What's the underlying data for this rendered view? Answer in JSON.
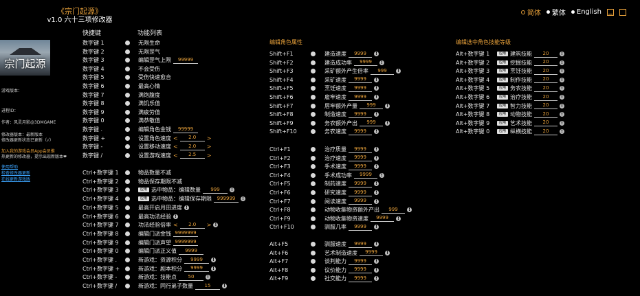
{
  "app": {
    "title": "《宗门起源》",
    "subtitle": "v1.0 六十三项修改器"
  },
  "lang": [
    {
      "label": "简体",
      "selected": true
    },
    {
      "label": "繁体",
      "selected": false
    },
    {
      "label": "English",
      "selected": false
    }
  ],
  "headers": {
    "hotkey": "快捷键",
    "features": "功能列表",
    "char_attr": "编辑角色属性",
    "skill_level": "编辑选中角色技能等级"
  },
  "logo_text": "宗门起源",
  "sidebar": [
    {
      "text": "游戏版本：",
      "cls": ""
    },
    {
      "text": "进程ID：",
      "cls": ""
    },
    {
      "text": "作者：风灵月影@3DMGAME",
      "cls": ""
    },
    {
      "text": "修改器版本：最新版本",
      "cls": ""
    },
    {
      "text": "修改器更新状态已更新（√）",
      "cls": ""
    },
    {
      "text": "加入我的游戏会员App会员推",
      "cls": "orange"
    },
    {
      "text": "热更新的修改器，提示出现新版本❤",
      "cls": ""
    },
    {
      "text": "使用帮助",
      "cls": "link"
    },
    {
      "text": "检查修改器更新",
      "cls": "link"
    },
    {
      "text": "在线更新游戏版",
      "cls": "link"
    }
  ],
  "col1": [
    {
      "key": "数字键 1",
      "label": "无限生命"
    },
    {
      "key": "数字键 2",
      "label": "无限罡气"
    },
    {
      "key": "数字键 3",
      "label": "编辑罡气上限",
      "value": "99999"
    },
    {
      "key": "数字键 4",
      "label": "不会受伤"
    },
    {
      "key": "数字键 5",
      "label": "受伤快速愈合"
    },
    {
      "key": "数字键 6",
      "label": "最高心情"
    },
    {
      "key": "数字键 7",
      "label": "满饱腹度"
    },
    {
      "key": "数字键 8",
      "label": "满饥乐值"
    },
    {
      "key": "数字键 9",
      "label": "满疲劳值"
    },
    {
      "key": "数字键 0",
      "label": "满恭敬值"
    },
    {
      "key": "数字键 .",
      "label": "编辑角色金钱",
      "value": "99999"
    },
    {
      "key": "数字键 +",
      "label": "设置角色速度",
      "value": "2.0",
      "arrows": true
    },
    {
      "key": "数字键 -",
      "label": "设置移动速度",
      "value": "2.0",
      "arrows": true
    },
    {
      "key": "数字键 /",
      "label": "设置游戏速度",
      "value": "2.5",
      "arrows": true
    }
  ],
  "col1b": [
    {
      "key": "Ctrl+数字键 1",
      "label": "物品数量不减"
    },
    {
      "key": "Ctrl+数字键 2",
      "label": "物品保存期限不减"
    },
    {
      "key": "Ctrl+数字键 3",
      "label": "选中物品：编辑数量",
      "value": "999",
      "apply": "应用",
      "info": true
    },
    {
      "key": "Ctrl+数字键 4",
      "label": "选中物品：编辑保存期限",
      "value": "999999",
      "apply": "应用",
      "info": true
    },
    {
      "key": "Ctrl+数字键 5",
      "label": "最高开启月田进度",
      "info": true
    },
    {
      "key": "Ctrl+数字键 6",
      "label": "最高功法经验",
      "info": true
    },
    {
      "key": "Ctrl+数字键 7",
      "label": "功法经验倍率",
      "value": "2.0",
      "arrows": true,
      "info": true
    },
    {
      "key": "Ctrl+数字键 8",
      "label": "编辑门派金钱",
      "value": "9999999"
    },
    {
      "key": "Ctrl+数字键 9",
      "label": "编辑门派声望",
      "value": "9999999"
    },
    {
      "key": "Ctrl+数字键 0",
      "label": "编辑门派正义值",
      "value": "9999"
    },
    {
      "key": "Ctrl+数字键 .",
      "label": "新游戏：资源积分",
      "value": "9999",
      "info": true
    },
    {
      "key": "Ctrl+数字键 +",
      "label": "新游戏：剧本积分",
      "value": "9999",
      "info": true
    },
    {
      "key": "Ctrl+数字键 -",
      "label": "新游戏：技能点",
      "value": "50",
      "info": true
    },
    {
      "key": "Ctrl+数字键 /",
      "label": "新游戏：同行弟子数量",
      "value": "15",
      "info": true
    }
  ],
  "col2": [
    {
      "key": "Shift+F1",
      "label": "建造速度",
      "value": "9999"
    },
    {
      "key": "Shift+F2",
      "label": "建造成功率",
      "value": "9999"
    },
    {
      "key": "Shift+F3",
      "label": "采矿额外产生倍率",
      "value": "999"
    },
    {
      "key": "Shift+F4",
      "label": "采矿速度",
      "value": "9999"
    },
    {
      "key": "Shift+F5",
      "label": "烹饪速度",
      "value": "9999"
    },
    {
      "key": "Shift+F6",
      "label": "雇牢速度",
      "value": "9999"
    },
    {
      "key": "Shift+F7",
      "label": "唇牢额外产量",
      "value": "999"
    },
    {
      "key": "Shift+F8",
      "label": "制造速度",
      "value": "9999"
    },
    {
      "key": "Shift+F9",
      "label": "务农额外产出",
      "value": "999"
    },
    {
      "key": "Shift+F10",
      "label": "务农速度",
      "value": "9999"
    }
  ],
  "col2b": [
    {
      "key": "Ctrl+F1",
      "label": "治疗质量",
      "value": "9999"
    },
    {
      "key": "Ctrl+F2",
      "label": "治疗速度",
      "value": "9999"
    },
    {
      "key": "Ctrl+F3",
      "label": "手术速度",
      "value": "9999"
    },
    {
      "key": "Ctrl+F4",
      "label": "手术成功率",
      "value": "9999"
    },
    {
      "key": "Ctrl+F5",
      "label": "制药速度",
      "value": "9999"
    },
    {
      "key": "Ctrl+F6",
      "label": "研究速度",
      "value": "9999"
    },
    {
      "key": "Ctrl+F7",
      "label": "阅读速度",
      "value": "9999"
    },
    {
      "key": "Ctrl+F8",
      "label": "动物收集物资额外产出",
      "value": "999"
    },
    {
      "key": "Ctrl+F9",
      "label": "动物收集物资速度",
      "value": "9999"
    },
    {
      "key": "Ctrl+F10",
      "label": "驯服几率",
      "value": "9999"
    }
  ],
  "col2c": [
    {
      "key": "Alt+F5",
      "label": "驯服速度",
      "value": "9999"
    },
    {
      "key": "Alt+F6",
      "label": "艺术制造速度",
      "value": "9999"
    },
    {
      "key": "Alt+F7",
      "label": "谈判能力",
      "value": "9999"
    },
    {
      "key": "Alt+F8",
      "label": "议价能力",
      "value": "9999"
    },
    {
      "key": "Alt+F9",
      "label": "社交能力",
      "value": "9999"
    }
  ],
  "col3": [
    {
      "key": "Alt+数字键 1",
      "apply": "应用",
      "label": "建筑技能",
      "value": "20"
    },
    {
      "key": "Alt+数字键 2",
      "apply": "应用",
      "label": "挖掘技能",
      "value": "20"
    },
    {
      "key": "Alt+数字键 3",
      "apply": "应用",
      "label": "烹饪技能",
      "value": "20"
    },
    {
      "key": "Alt+数字键 4",
      "apply": "应用",
      "label": "制作技能",
      "value": "20"
    },
    {
      "key": "Alt+数字键 5",
      "apply": "应用",
      "label": "务农技能",
      "value": "20"
    },
    {
      "key": "Alt+数字键 6",
      "apply": "应用",
      "label": "治疗技能",
      "value": "20"
    },
    {
      "key": "Alt+数字键 7",
      "apply": "应用",
      "label": "智力技能",
      "value": "20"
    },
    {
      "key": "Alt+数字键 8",
      "apply": "应用",
      "label": "动物技能",
      "value": "20"
    },
    {
      "key": "Alt+数字键 9",
      "apply": "应用",
      "label": "艺术技能",
      "value": "20"
    },
    {
      "key": "Alt+数字键 0",
      "apply": "应用",
      "label": "纵横技能",
      "value": "20"
    }
  ]
}
